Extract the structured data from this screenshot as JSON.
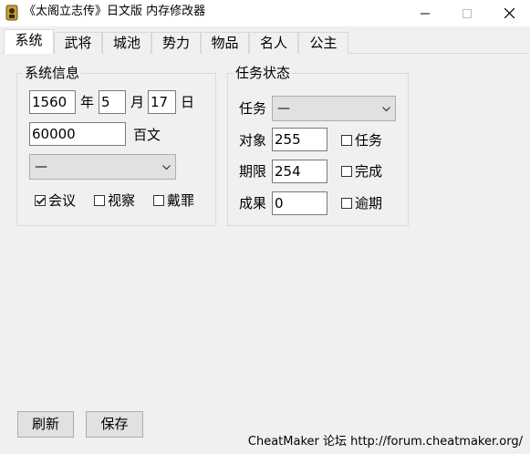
{
  "window": {
    "title": "《太阁立志传》日文版 内存修改器",
    "icon": "app-icon",
    "controls": [
      "minimize-icon",
      "maximize-icon",
      "close-icon"
    ]
  },
  "tabs": [
    {
      "label": "系统",
      "active": true
    },
    {
      "label": "武将"
    },
    {
      "label": "城池"
    },
    {
      "label": "势力"
    },
    {
      "label": "物品"
    },
    {
      "label": "名人"
    },
    {
      "label": "公主"
    }
  ],
  "system_info": {
    "title": "系统信息",
    "year": "1560",
    "year_unit": "年",
    "month": "5",
    "month_unit": "月",
    "day": "17",
    "day_unit": "日",
    "money": "60000",
    "money_unit": "百文",
    "dropdown_value": "—",
    "checkboxes": [
      {
        "label": "会议",
        "checked": true
      },
      {
        "label": "视察",
        "checked": false
      },
      {
        "label": "戴罪",
        "checked": false
      }
    ]
  },
  "task_status": {
    "title": "任务状态",
    "task_label": "任务",
    "task_value": "—",
    "target_label": "对象",
    "target_value": "255",
    "deadline_label": "期限",
    "deadline_value": "254",
    "result_label": "成果",
    "result_value": "0",
    "checkboxes": [
      {
        "label": "任务",
        "checked": false
      },
      {
        "label": "完成",
        "checked": false
      },
      {
        "label": "逾期",
        "checked": false
      }
    ]
  },
  "buttons": {
    "refresh": "刷新",
    "save": "保存"
  },
  "footer": "CheatMaker 论坛 http://forum.cheatmaker.org/"
}
